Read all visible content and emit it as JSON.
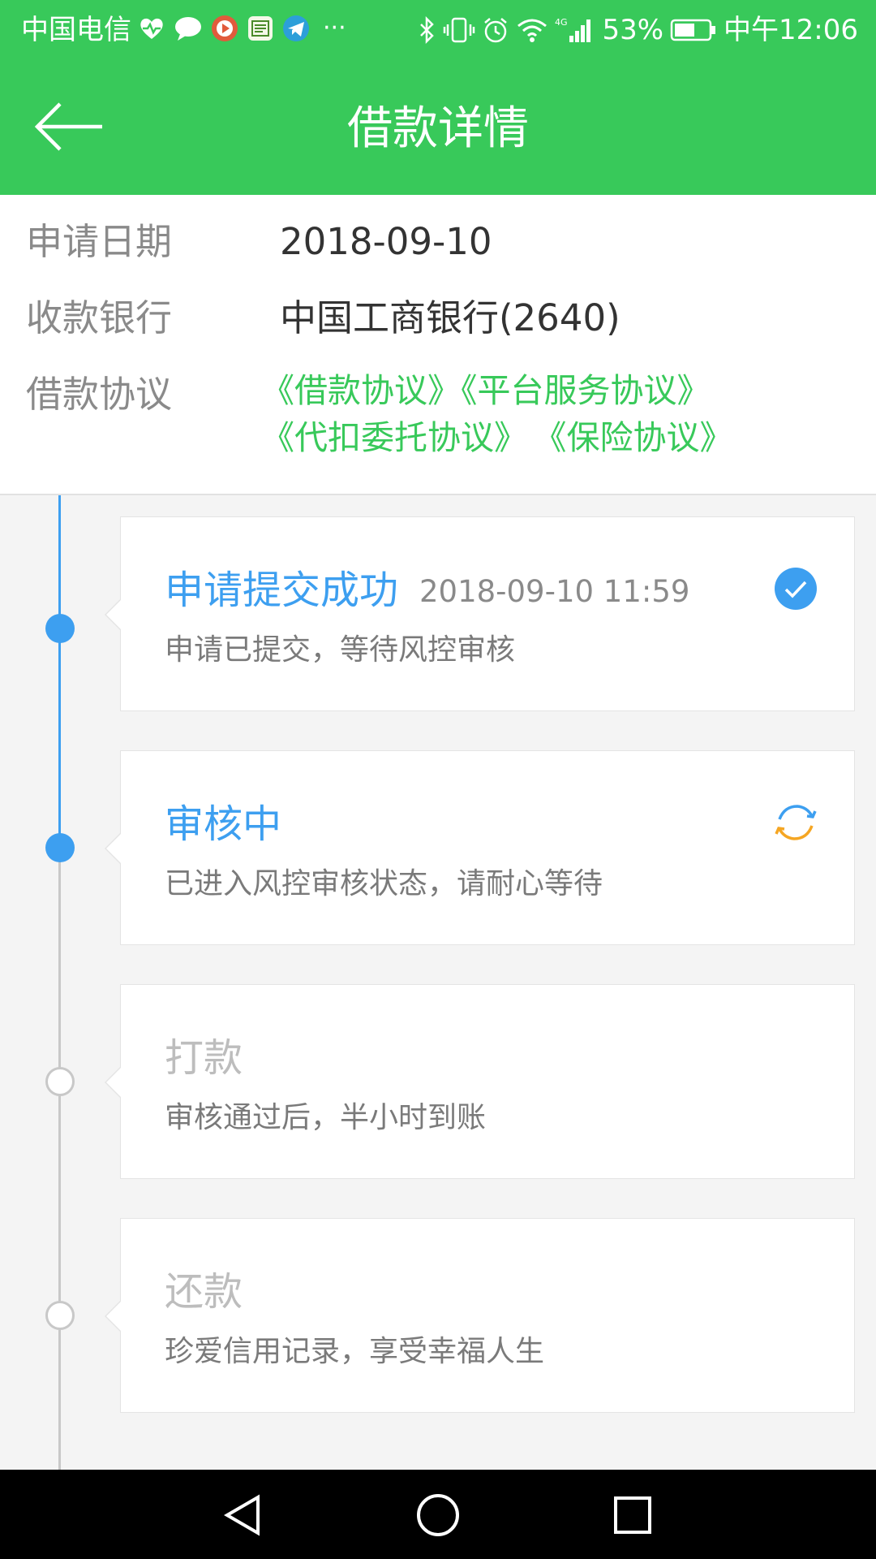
{
  "status_bar": {
    "carrier": "中国电信",
    "more": "···",
    "battery_pct": "53%",
    "time": "中午12:06"
  },
  "header": {
    "title": "借款详情"
  },
  "info": {
    "date_label": "申请日期",
    "date_value": "2018-09-10",
    "bank_label": "收款银行",
    "bank_value": "中国工商银行(2640)",
    "agreement_label": "借款协议",
    "agreements": [
      "《借款协议》",
      "《平台服务协议》",
      "《代扣委托协议》",
      "《保险协议》"
    ]
  },
  "steps": [
    {
      "title": "申请提交成功",
      "time": "2018-09-10 11:59",
      "desc": "申请已提交，等待风控审核",
      "status": "done",
      "icon": "check-circle-icon"
    },
    {
      "title": "审核中",
      "time": "",
      "desc": "已进入风控审核状态，请耐心等待",
      "status": "in-progress",
      "icon": "refresh-icon"
    },
    {
      "title": "打款",
      "time": "",
      "desc": "审核通过后，半小时到账",
      "status": "pending"
    },
    {
      "title": "还款",
      "time": "",
      "desc": "珍爱信用记录，享受幸福人生",
      "status": "pending"
    }
  ],
  "colors": {
    "brand": "#38c95a",
    "active": "#3d9ff0",
    "pending": "#c8c8c8",
    "refresh": "#f5a623"
  }
}
